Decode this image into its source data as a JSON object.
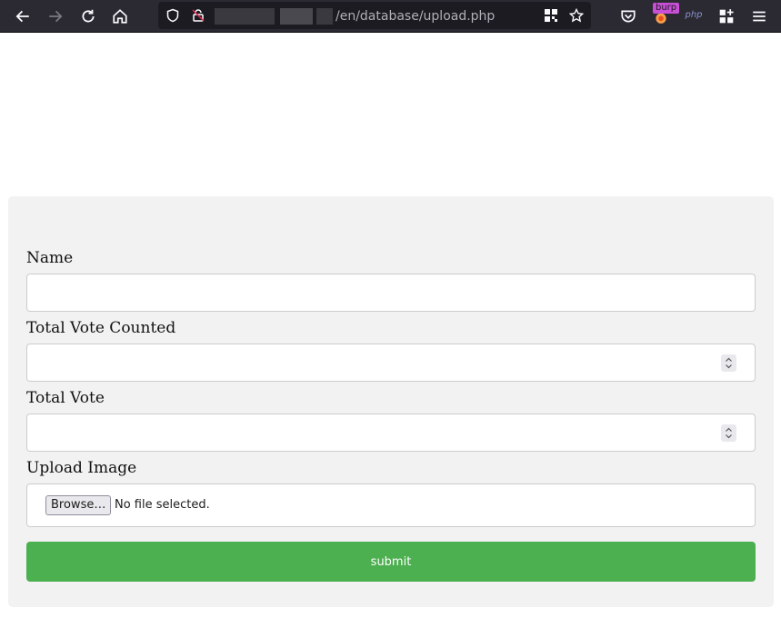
{
  "browser": {
    "url_visible_path": "/en/database/upload.php",
    "nav_icons": [
      "back-arrow-icon",
      "forward-arrow-icon",
      "reload-icon",
      "home-icon"
    ],
    "url_icons": [
      "shield-icon",
      "lock-warning-icon",
      "qr-code-icon",
      "bookmark-star-icon"
    ],
    "extension_icons": [
      "pocket-icon",
      "burp-extension-icon",
      "php-extension-icon",
      "extensions-icon",
      "menu-icon"
    ],
    "burp_badge_label": "burp",
    "php_label": "php"
  },
  "form": {
    "name_label": "Name",
    "name_value": "",
    "total_vote_counted_label": "Total Vote Counted",
    "total_vote_counted_value": "",
    "total_vote_label": "Total Vote",
    "total_vote_value": "",
    "upload_image_label": "Upload Image",
    "browse_button_label": "Browse…",
    "file_status": "No file selected.",
    "submit_label": "submit"
  },
  "colors": {
    "toolbar_bg": "#2b2a33",
    "card_bg": "#f2f2f2",
    "submit_bg": "#4caf50"
  }
}
